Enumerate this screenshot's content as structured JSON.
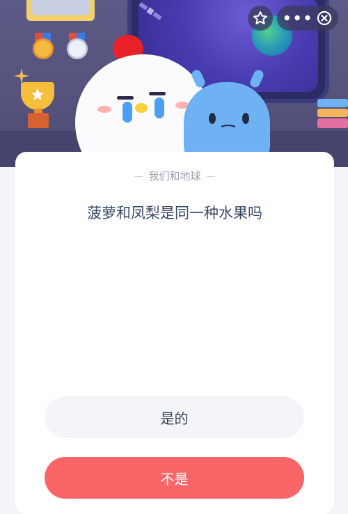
{
  "quiz": {
    "category": "我们和地球",
    "question": "菠萝和凤梨是同一种水果吗",
    "options": [
      {
        "label": "是的"
      },
      {
        "label": "不是"
      }
    ]
  },
  "colors": {
    "accent": "#fa6668",
    "card_bg": "#ffffff",
    "scene_bg": "#5c5a86",
    "option_neutral": "#f4f5f8"
  },
  "icons": {
    "favorite": "star-outline-icon",
    "more": "more-dots-icon",
    "planet": "earth-icon",
    "close": "close-circle-icon"
  }
}
